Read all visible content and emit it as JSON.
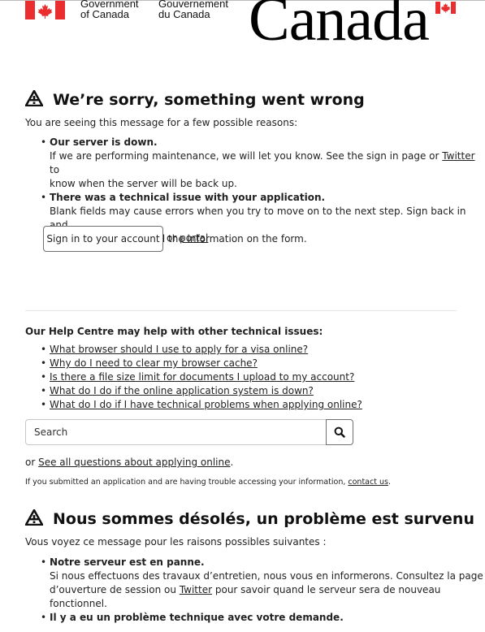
{
  "header": {
    "signature_en": [
      "Government",
      "of Canada"
    ],
    "signature_fr": [
      "Gouvernement",
      "du Canada"
    ],
    "wordmark": "Canada",
    "flag_color": "#ea2d2e"
  },
  "en": {
    "icon": "warning-icon",
    "title": "We’re sorry, something went wrong",
    "intro": "You are seeing this message for a few possible reasons:",
    "reasons": [
      {
        "heading": "Our server is down.",
        "text_before": "If we are performing maintenance, we will let you know. See the sign in page or",
        "link": "Twitter",
        "text_after": "to",
        "line2": "know when the server will be back up."
      },
      {
        "heading": "There was a technical issue with your application.",
        "line1": "Blank fields may cause errors when you try to move on to the next step. Sign back in and",
        "line2": "make sure you enter all the information on the form."
      }
    ],
    "signin_button": "Sign in to your account",
    "or": "or",
    "portal_link": "portal"
  },
  "help": {
    "heading": "Our Help Centre may help with other technical issues:",
    "links": [
      "What browser should I use to apply for a visa online?",
      "Why do I need to clear my browser cache?",
      "Is there a file size limit for documents I upload to my account?",
      "What do I do if the online application system is down?",
      "What do I do if I have technical problems when applying online?"
    ],
    "search_placeholder": "Search",
    "search_icon": "search-icon",
    "or": "or",
    "see_all_link": "See all questions about applying online",
    "see_all_suffix": ".",
    "contact_text": "If you submitted an application and are having trouble accessing your information,",
    "contact_link": "contact us",
    "contact_suffix": "."
  },
  "fr": {
    "icon": "warning-icon",
    "title": "Nous sommes désolés, un problème est survenu",
    "intro": "Vous voyez ce message pour les raisons possibles suivantes :",
    "reasons": [
      {
        "heading": "Notre serveur est en panne.",
        "line1": "Si nous effectuons des travaux d’entretien, nous vous en informerons. Consultez la page",
        "line2_before": "d’ouverture de session ou",
        "link": "Twitter",
        "line2_after": "pour savoir quand le serveur sera de nouveau",
        "line3": "fonctionnel."
      },
      {
        "heading": "Il y a eu un problème technique avec votre demande."
      }
    ]
  }
}
